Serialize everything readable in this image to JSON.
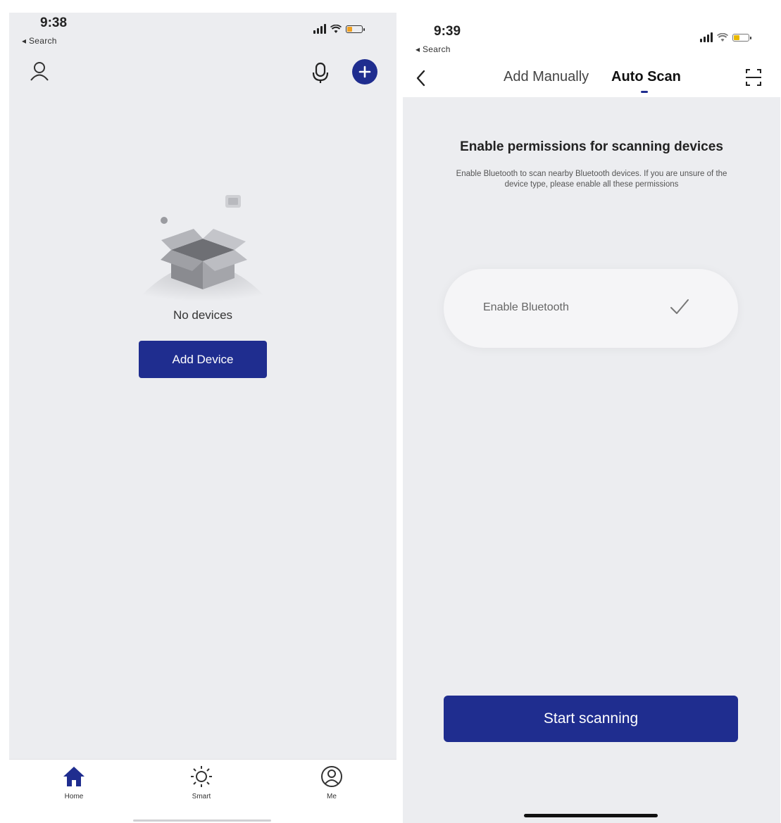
{
  "left_screen": {
    "status_bar": {
      "time": "9:38",
      "back_label": "◂ Search"
    },
    "empty_state": {
      "message": "No devices",
      "button_label": "Add Device"
    },
    "tab_bar": {
      "items": [
        {
          "label": "Home",
          "icon": "home-icon",
          "active": true
        },
        {
          "label": "Smart",
          "icon": "sun-icon",
          "active": false
        },
        {
          "label": "Me",
          "icon": "profile-icon",
          "active": false
        }
      ]
    }
  },
  "right_screen": {
    "status_bar": {
      "time": "9:39",
      "back_label": "◂ Search"
    },
    "header": {
      "tabs": [
        {
          "label": "Add Manually",
          "active": false
        },
        {
          "label": "Auto Scan",
          "active": true
        }
      ]
    },
    "permissions": {
      "title": "Enable permissions for scanning devices",
      "description": "Enable Bluetooth to scan nearby Bluetooth devices. If you are unsure of the device type, please enable all these permissions",
      "bluetooth_label": "Enable Bluetooth"
    },
    "button_label": "Start scanning"
  },
  "colors": {
    "primary": "#1f2d8f",
    "background": "#ecedf0",
    "battery_low": "#f0a020",
    "battery_warn": "#e8b800"
  }
}
